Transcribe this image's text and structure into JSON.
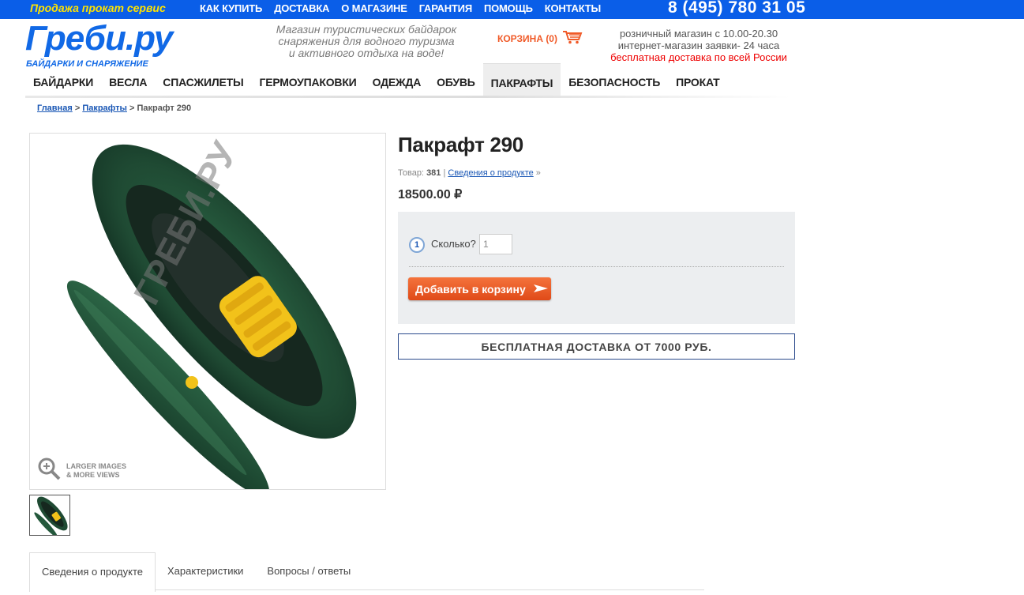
{
  "topbar": {
    "tagline": "Продажа прокат сервис",
    "links": [
      "КАК КУПИТЬ",
      "ДОСТАВКА",
      "О МАГАЗИНЕ",
      "ГАРАНТИЯ",
      "ПОМОЩЬ",
      "КОНТАКТЫ"
    ],
    "phone": "8 (495) 780 31 05",
    "bg_color": "#0a5ee8"
  },
  "header": {
    "logo": "Греби.ру",
    "logo_sub": "БАЙДАРКИ И СНАРЯЖЕНИЕ",
    "slogan_lines": [
      "Магазин туристических байдарок",
      "снаряжения для водного туризма",
      "и активного отдыха на воде!"
    ],
    "cart_label": "КОРЗИНА (0)",
    "cart_icon": "cart-icon",
    "info_lines": [
      "розничный магазин с 10.00-20.30",
      "интернет-магазин заявки- 24 часа"
    ],
    "info_red": "бесплатная доставка по всей России"
  },
  "nav": {
    "items": [
      "БАЙДАРКИ",
      "ВЕСЛА",
      "СПАСЖИЛЕТЫ",
      "ГЕРМОУПАКОВКИ",
      "ОДЕЖДА",
      "ОБУВЬ",
      "ПАКРАФТЫ",
      "БЕЗОПАСНОСТЬ",
      "ПРОКАТ"
    ],
    "active": "ПАКРАФТЫ"
  },
  "breadcrumb": {
    "home": "Главная",
    "sep": ">",
    "category": "Пакрафты",
    "current": "Пакрафт 290"
  },
  "product": {
    "title": "Пакрафт 290",
    "sku_label": "Товар:",
    "sku": "381",
    "sep": "|",
    "details_link": "Сведения о продукте",
    "details_arrow": "»",
    "price": "18500.00 ₽",
    "watermark": "ГРЕБИ.РУ",
    "zoom_line1": "LARGER IMAGES",
    "zoom_line2": "& MORE VIEWS"
  },
  "buy": {
    "step": "1",
    "qty_label": "Сколько?",
    "qty_value": "1",
    "add_button": "Добавить в корзину"
  },
  "free_shipping": "БЕСПЛАТНАЯ ДОСТАВКА ОТ 7000 РУБ.",
  "tabs": [
    "Сведения о продукте",
    "Характеристики",
    "Вопросы / ответы"
  ],
  "colors": {
    "brand_blue": "#1169e6",
    "accent_orange": "#f05a28",
    "boat_green": "#1f4a33",
    "seat_yellow": "#f2c21a"
  }
}
